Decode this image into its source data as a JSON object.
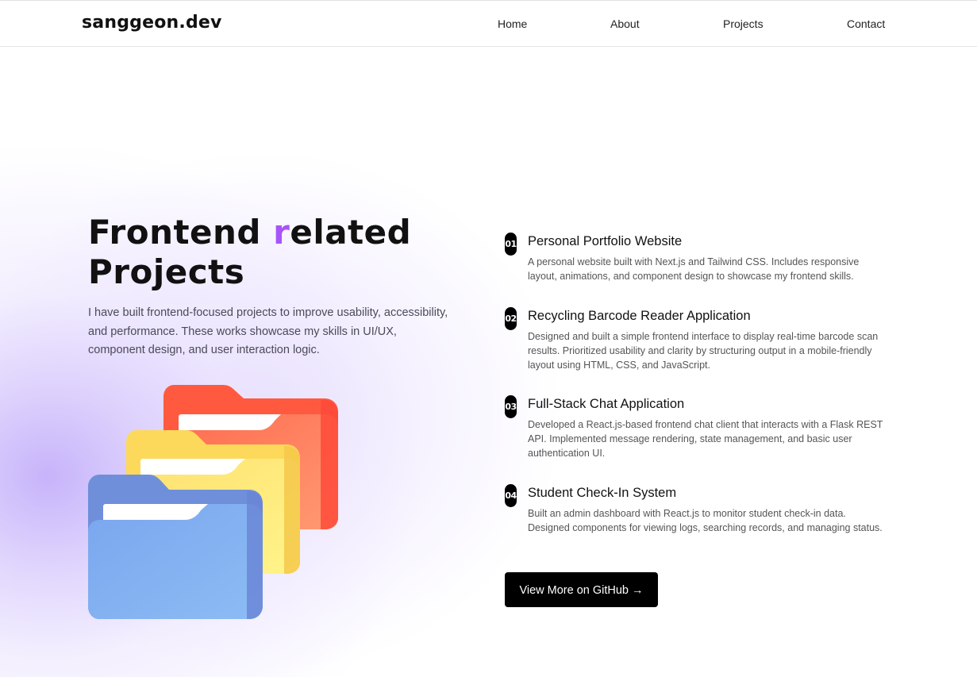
{
  "header": {
    "logo": "sanggeon.dev",
    "nav": [
      "Home",
      "About",
      "Projects",
      "Contact"
    ]
  },
  "hero": {
    "title_part1": "Frontend ",
    "title_accent": "r",
    "title_part2": "elated",
    "title_line2": "Projects",
    "description": "I have built frontend-focused projects to improve usability, accessibility, and performance. These works showcase my skills in UI/UX, component design, and user interaction logic.",
    "accent_color": "#a855f7",
    "illustration_icons": [
      "folder-red-icon",
      "folder-yellow-icon",
      "folder-blue-icon"
    ]
  },
  "projects": [
    {
      "num": "01",
      "title": "Personal Portfolio Website",
      "description": "A personal website built with Next.js and Tailwind CSS. Includes responsive layout, animations, and component design to showcase my frontend skills."
    },
    {
      "num": "02",
      "title": "Recycling Barcode Reader Application",
      "description": "Designed and built a simple frontend interface to display real-time barcode scan results. Prioritized usability and clarity by structuring output in a mobile-friendly layout using HTML, CSS, and JavaScript."
    },
    {
      "num": "03",
      "title": "Full-Stack Chat Application",
      "description": "Developed a React.js-based frontend chat client that interacts with a Flask REST API. Implemented message rendering, state management, and basic user authentication UI."
    },
    {
      "num": "04",
      "title": "Student Check-In System",
      "description": "Built an admin dashboard with React.js to monitor student check-in data. Designed components for viewing logs, searching records, and managing status."
    }
  ],
  "cta": {
    "label": "View More on GitHub →"
  }
}
